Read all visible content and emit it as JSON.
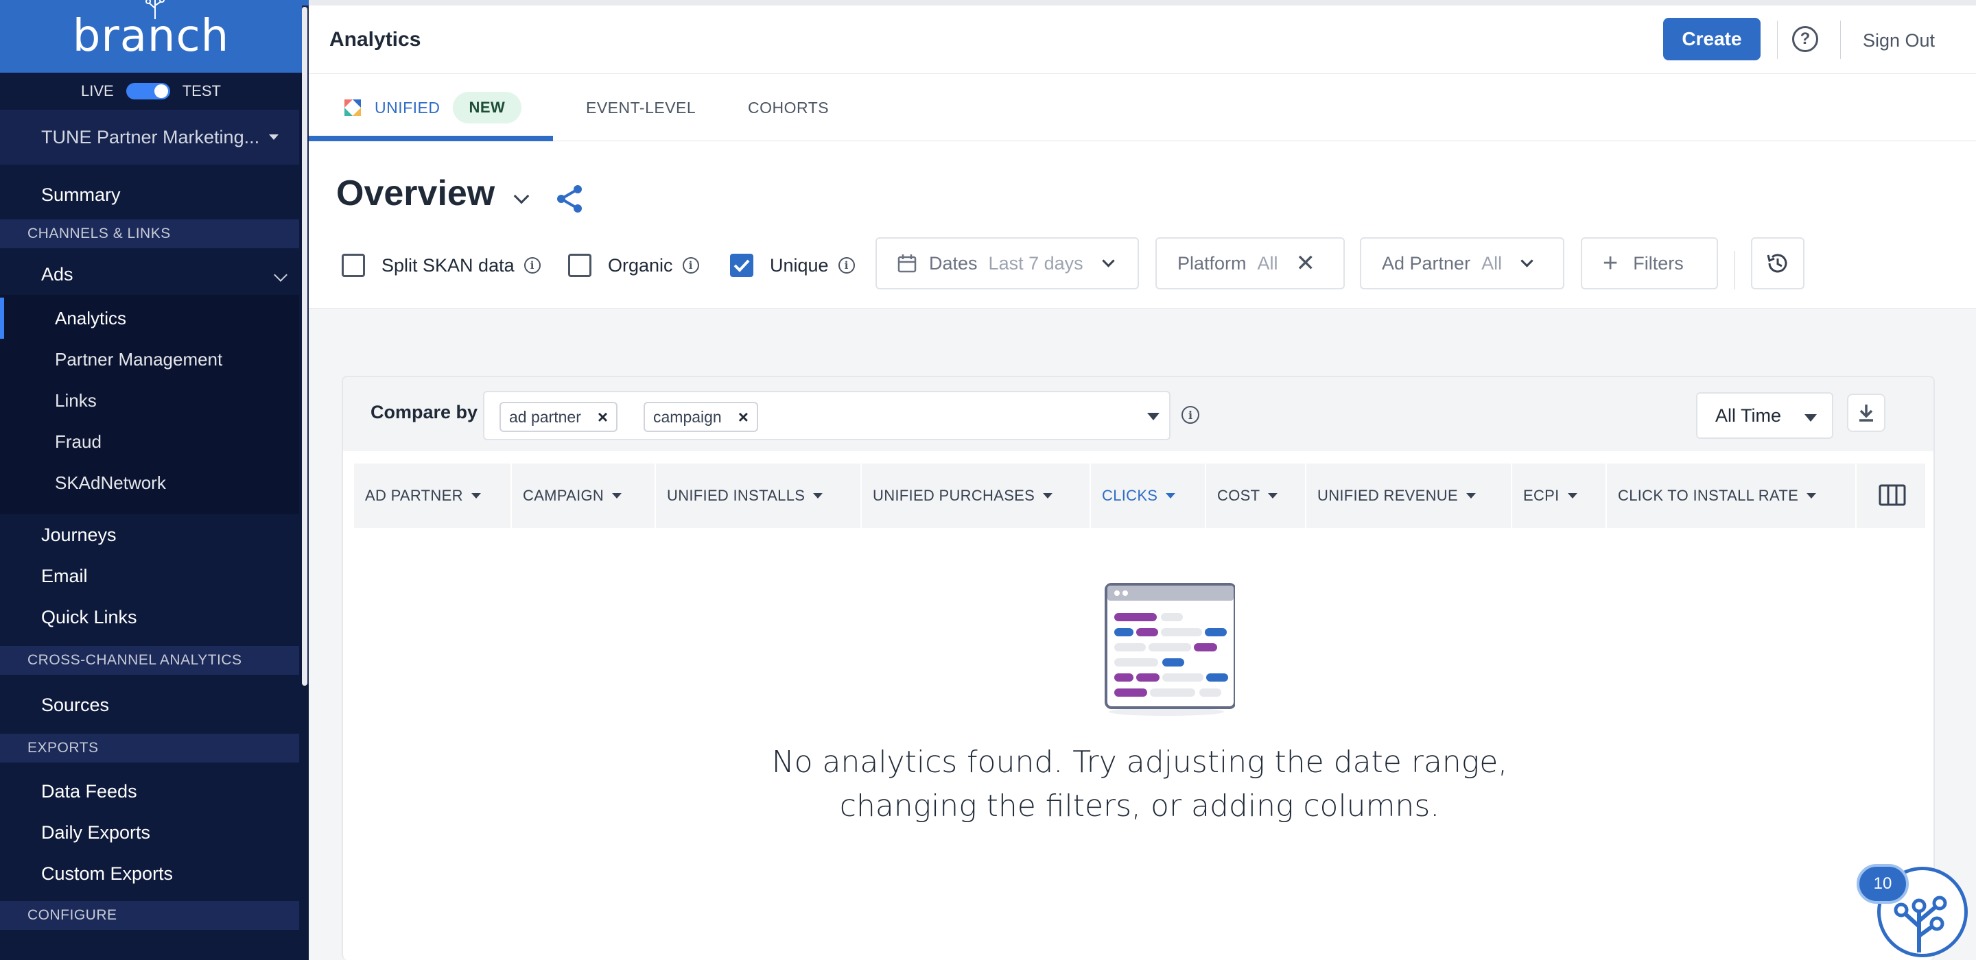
{
  "sidebar": {
    "logo": "branch",
    "env_live": "LIVE",
    "env_test": "TEST",
    "org": "TUNE Partner Marketing...",
    "summary": "Summary",
    "sections": {
      "channels": "CHANNELS & LINKS",
      "cross": "CROSS-CHANNEL ANALYTICS",
      "exports": "EXPORTS",
      "configure": "CONFIGURE"
    },
    "ads": "Ads",
    "ads_items": [
      "Analytics",
      "Partner Management",
      "Links",
      "Fraud",
      "SKAdNetwork"
    ],
    "journeys": "Journeys",
    "email": "Email",
    "quick_links": "Quick Links",
    "sources": "Sources",
    "data_feeds": "Data Feeds",
    "daily_exports": "Daily Exports",
    "custom_exports": "Custom Exports"
  },
  "topbar": {
    "title": "Analytics",
    "create": "Create",
    "help": "?",
    "sign_out": "Sign Out"
  },
  "tabs": {
    "unified": "UNIFIED",
    "new_badge": "NEW",
    "event_level": "EVENT-LEVEL",
    "cohorts": "COHORTS"
  },
  "overview": {
    "title": "Overview",
    "split_skan": "Split SKAN data",
    "organic": "Organic",
    "unique": "Unique",
    "dates_label": "Dates",
    "dates_value": "Last 7 days",
    "platform_label": "Platform",
    "platform_value": "All",
    "ad_partner_label": "Ad Partner",
    "ad_partner_value": "All",
    "filters": "Filters"
  },
  "compare": {
    "label": "Compare by",
    "chips": [
      "ad partner",
      "campaign"
    ],
    "time_range": "All Time"
  },
  "table": {
    "columns": [
      "AD PARTNER",
      "CAMPAIGN",
      "UNIFIED INSTALLS",
      "UNIFIED PURCHASES",
      "CLICKS",
      "COST",
      "UNIFIED REVENUE",
      "ECPI",
      "CLICK TO INSTALL RATE"
    ],
    "active_column": "CLICKS"
  },
  "empty": {
    "line1": "No analytics found. Try adjusting the date range,",
    "line2": "changing the filters, or adding columns."
  },
  "helper": {
    "count": "10"
  },
  "colors": {
    "primary": "#2f6cc6",
    "sidebar": "#0e1a3b",
    "accent_purple": "#8e3fa3"
  }
}
